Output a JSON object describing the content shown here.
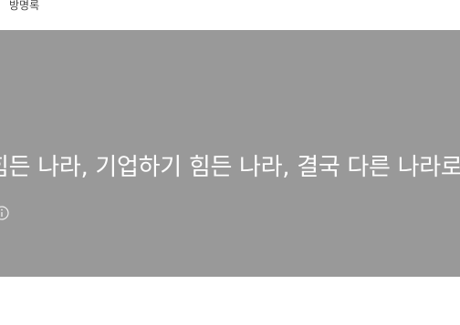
{
  "nav": {
    "guestbook_label": "방명록"
  },
  "hero": {
    "title": "힘든 나라, 기업하기 힘든 나라, 결국 다른 나라로",
    "background_color": "#999999",
    "text_color": "#ffffff",
    "info_icon": "info-circle-icon"
  }
}
